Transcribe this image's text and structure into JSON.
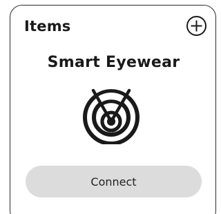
{
  "header": {
    "title": "Items"
  },
  "device": {
    "name": "Smart Eyewear",
    "icon": "target-signal-icon"
  },
  "actions": {
    "connect_label": "Connect",
    "add_icon": "plus-circle-icon"
  },
  "colors": {
    "card_border": "#2a2a2a",
    "button_bg": "#dcdcdc",
    "text": "#1a1a1a"
  }
}
